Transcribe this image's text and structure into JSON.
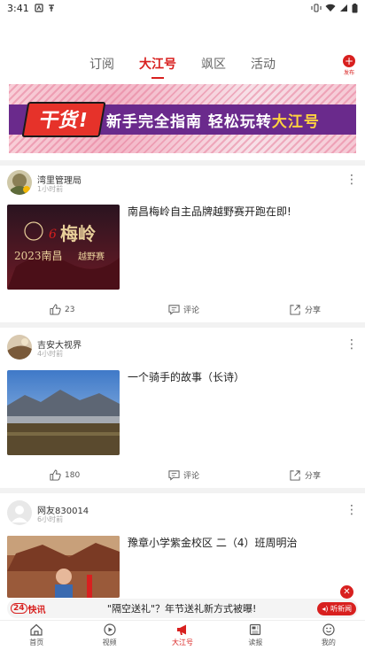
{
  "status_bar": {
    "time": "3:41"
  },
  "tabs": [
    {
      "label": "订阅",
      "active": false
    },
    {
      "label": "大江号",
      "active": true
    },
    {
      "label": "飒区",
      "active": false
    },
    {
      "label": "活动",
      "active": false
    }
  ],
  "publish": {
    "label": "发布"
  },
  "banner": {
    "badge": "干货!",
    "text_a": "新手完全指南 轻松玩转",
    "text_b": "大江号"
  },
  "posts": [
    {
      "author": "湾里管理局",
      "time": "1小时前",
      "title": "南昌梅岭自主品牌越野赛开跑在即!",
      "thumb": {
        "title": "梅岭",
        "year_city": "2023南昌",
        "event": "越野赛",
        "num": "6"
      },
      "likes": "23",
      "comment_label": "评论",
      "share_label": "分享"
    },
    {
      "author": "吉安大视界",
      "time": "4小时前",
      "title": "一个骑手的故事（长诗）",
      "likes": "180",
      "comment_label": "评论",
      "share_label": "分享"
    },
    {
      "author": "网友830014",
      "time": "6小时前",
      "title": "豫章小学紫金校区  二（4）班周明治"
    }
  ],
  "ticker": {
    "logo_num": "24",
    "logo_text": "快讯",
    "text": "\"隔空送礼\"？年节送礼新方式被曝!",
    "listen": "听新闻"
  },
  "bottom_nav": [
    {
      "label": "首页",
      "icon": "home-icon",
      "active": false
    },
    {
      "label": "视频",
      "icon": "play-icon",
      "active": false
    },
    {
      "label": "大江号",
      "icon": "megaphone-icon",
      "active": true
    },
    {
      "label": "读报",
      "icon": "newspaper-icon",
      "active": false
    },
    {
      "label": "我的",
      "icon": "smile-icon",
      "active": false
    }
  ],
  "colors": {
    "accent": "#d8201f"
  }
}
